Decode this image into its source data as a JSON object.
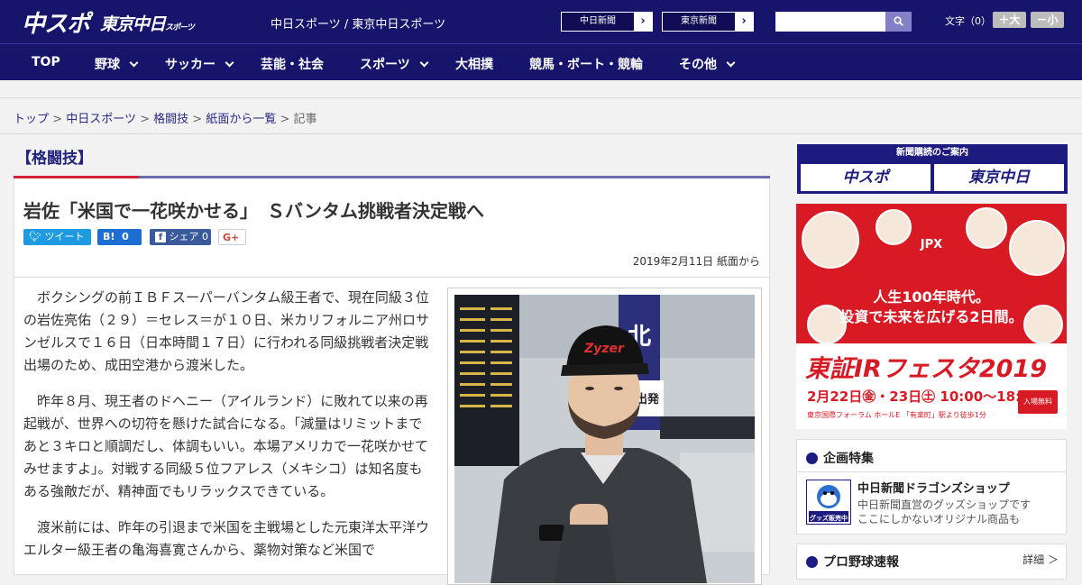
{
  "header": {
    "logo_chuspo": "中スポ",
    "logo_tokyo": "東京中日",
    "logo_tokyo_suffix": "スポーツ",
    "site_name": "中日スポーツ / 東京中日スポーツ",
    "paper_links": [
      "中日新聞",
      "東京新聞"
    ],
    "search": {
      "placeholder": "",
      "value": ""
    },
    "font_size_label": "文字（0）",
    "font_larger": "＋大",
    "font_smaller": "－小"
  },
  "nav": {
    "items": [
      {
        "label": "TOP",
        "has_menu": false
      },
      {
        "label": "野球",
        "has_menu": true
      },
      {
        "label": "サッカー",
        "has_menu": true
      },
      {
        "label": "芸能・社会",
        "has_menu": false
      },
      {
        "label": "スポーツ",
        "has_menu": true
      },
      {
        "label": "大相撲",
        "has_menu": false
      },
      {
        "label": "競馬・ボート・競輪",
        "has_menu": false
      },
      {
        "label": "その他",
        "has_menu": true
      }
    ]
  },
  "breadcrumb": {
    "items": [
      "トップ",
      "中日スポーツ",
      "格闘技",
      "紙面から一覧",
      "記事"
    ],
    "separator": ">"
  },
  "article": {
    "category": "【格闘技】",
    "headline": "岩佐「米国で一花咲かせる」　Ｓバンタム挑戦者決定戦へ",
    "share": {
      "tweet": "ツイート",
      "hatena_mark": "B!",
      "hatena_count": "0",
      "facebook": "シェア",
      "facebook_count": "0",
      "gplus": "G+"
    },
    "dateline": "2019年2月11日 紙面から",
    "paragraphs": [
      "ボクシングの前ＩＢＦスーパーバンタム級王者で、現在同級３位の岩佐亮佑（２９）＝セレス＝が１０日、米カリフォルニア州ロサンゼルスで１６日（日本時間１７日）に行われる同級挑戦者決定戦出場のため、成田空港から渡米した。",
      "昨年８月、現王者のドヘニー（アイルランド）に敗れて以来の再起戦が、世界への切符を懸けた試合になる。「減量はリミットまであと３キロと順調だし、体調もいい。本場アメリカで一花咲かせてみせますよ」。対戦する同級５位フアレス（メキシコ）は知名度もある強敵だが、精神面でもリラックスできている。",
      "渡米前には、昨年の引退まで米国を主戦場とした元東洋太平洋ウエルター級王者の亀海喜寛さんから、薬物対策など米国で"
    ],
    "photo": {
      "sign_vertical": "北",
      "sign_depart": "出発",
      "cap_text": "Zyzer"
    }
  },
  "sidebar": {
    "subscribe": {
      "title": "新聞購読のご案内",
      "brand1": "中スポ",
      "brand2": "東京中日"
    },
    "ad": {
      "brand": "JPX",
      "line1": "人生100年時代。",
      "line2": "投資で未来を広げる2日間。",
      "fest": "東証IRフェスタ2019",
      "date": "2月22日㊎・23日㊏ 10:00～18:00",
      "venue": "東京国際フォーラム ホールE 「有楽町」駅より徒歩1分",
      "free": "入場無料"
    },
    "features": {
      "title": "企画特集",
      "item_title": "中日新聞ドラゴンズショップ",
      "item_desc1": "中日新聞直営のグッズショップです",
      "item_desc2": "ここにしかないオリジナル商品も",
      "logo_text": "グッズ販売中"
    },
    "baseball": {
      "title": "プロ野球速報",
      "more": "詳細 ＞"
    }
  },
  "colors": {
    "header_bg": "#17156b",
    "accent_red": "#d4213a",
    "ad_red": "#d81a24"
  }
}
